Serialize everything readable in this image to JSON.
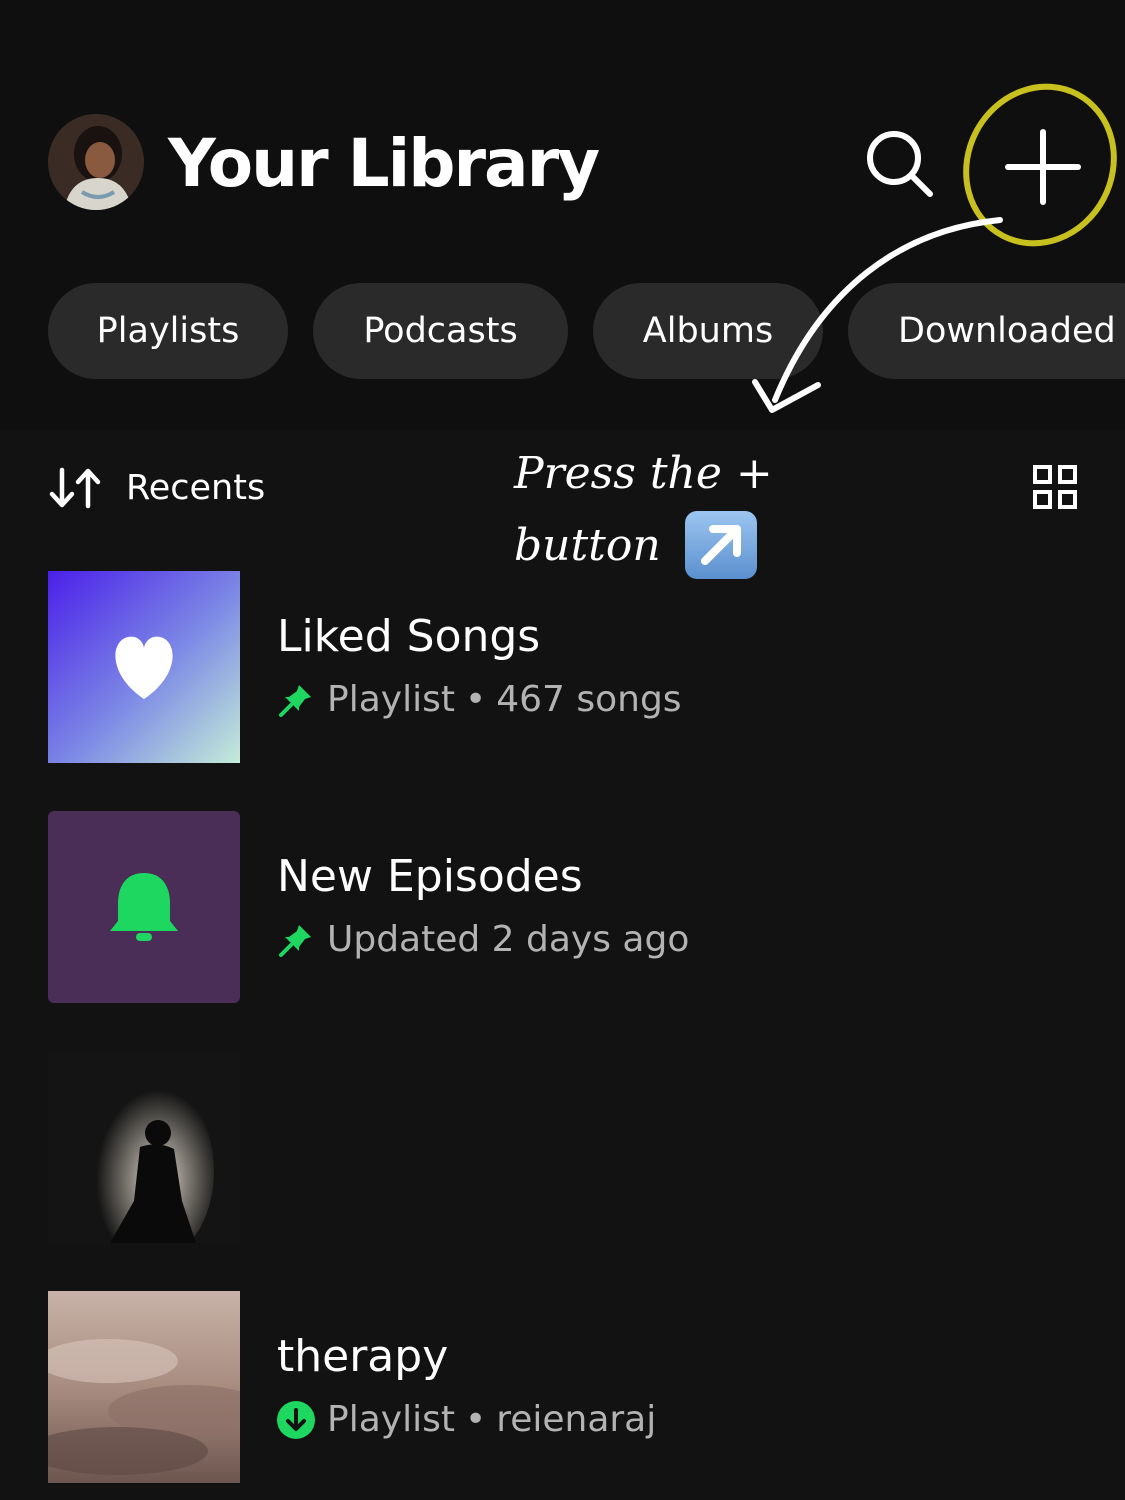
{
  "header": {
    "title": "Your Library",
    "avatar_icon": "user-avatar",
    "search_icon": "search-icon",
    "create_icon": "plus-icon"
  },
  "filters": [
    {
      "label": "Playlists"
    },
    {
      "label": "Podcasts"
    },
    {
      "label": "Albums"
    },
    {
      "label": "Downloaded"
    }
  ],
  "sort": {
    "label": "Recents",
    "icon": "sort-arrows-icon",
    "view_icon": "grid-view-icon"
  },
  "annotation": {
    "line1": "Press the +",
    "line2": "button",
    "emoji": "up-right-arrow-emoji",
    "highlight_color": "#c8c01e"
  },
  "items": [
    {
      "title": "Liked Songs",
      "type": "Playlist",
      "meta": "467 songs",
      "badge": "pin-icon",
      "cover": "heart-gradient"
    },
    {
      "title": "New Episodes",
      "type": "",
      "meta": "Updated 2 days ago",
      "badge": "pin-icon",
      "cover": "bell-purple"
    },
    {
      "title": "",
      "type": "",
      "meta": "",
      "cover": "silhouette-photo"
    },
    {
      "title": "therapy",
      "type": "Playlist",
      "meta": "reienaraj",
      "badge": "download-icon",
      "cover": "clouds-photo"
    }
  ],
  "colors": {
    "background": "#121212",
    "chip": "#2a2a2a",
    "accent_green": "#1ed760",
    "secondary_text": "#b3b3b3"
  }
}
